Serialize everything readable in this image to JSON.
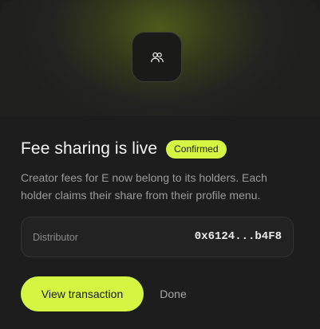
{
  "hero": {
    "icon": "users-icon"
  },
  "header": {
    "title": "Fee sharing is live",
    "badge": "Confirmed"
  },
  "description": "Creator fees for E now belong to its holders. Each holder claims their share from their profile menu.",
  "distributor": {
    "label": "Distributor",
    "value": "0x6124...b4F8"
  },
  "actions": {
    "primary_label": "View transaction",
    "secondary_label": "Done"
  },
  "colors": {
    "accent": "#d4f542",
    "background": "#1d1d1d"
  }
}
